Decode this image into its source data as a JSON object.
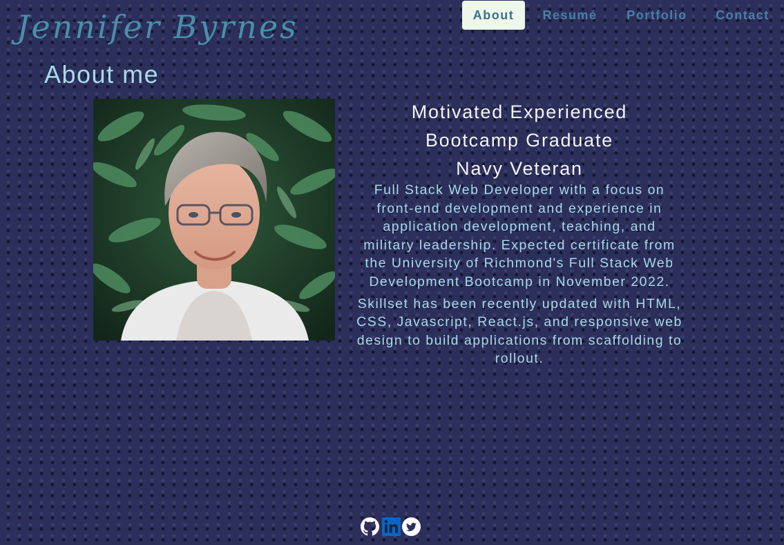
{
  "header": {
    "site_name": "Jennifer Byrnes",
    "nav": {
      "about": "About",
      "resume": "Resumé",
      "portfolio": "Portfolio",
      "contact": "Contact"
    },
    "active_tab": "About"
  },
  "main": {
    "title": "About me",
    "photo_icon": "profile-photo",
    "headline": [
      "Motivated Experienced",
      "Bootcamp Graduate",
      "Navy Veteran"
    ],
    "paragraphs": [
      "Full Stack Web Developer with a focus on front-end development and experience in application development, teaching, and military leadership. Expected certificate from the University of Richmond's Full Stack Web Development Bootcamp in November 2022.",
      "Skillset has been recently updated with HTML, CSS, Javascript, React.js, and responsive web design to build applications from scaffolding to rollout."
    ]
  },
  "footer": {
    "social": [
      {
        "icon": "github-icon"
      },
      {
        "icon": "linkedin-icon"
      },
      {
        "icon": "twitter-icon"
      }
    ]
  },
  "colors": {
    "background": "#2c2f5a",
    "accent_light": "#a9d9ea",
    "name_color": "#4a8fa8",
    "nav_color": "#4a7fa6",
    "active_tab_bg": "#edf7ea",
    "linkedin_blue": "#0a66c2"
  }
}
